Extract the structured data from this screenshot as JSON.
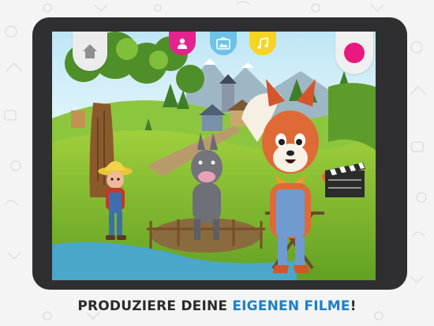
{
  "caption": {
    "part1": "PRODUZIERE DEINE ",
    "highlight": "EIGENEN FILME",
    "part2": "!"
  },
  "toolbar": {
    "home_icon": "home-icon",
    "tabs": [
      {
        "name": "character",
        "icon": "person-icon",
        "color": "#e5238f"
      },
      {
        "name": "scene",
        "icon": "scene-icon",
        "color": "#6cc3e8"
      },
      {
        "name": "music",
        "icon": "music-note-icon",
        "color": "#f5d422"
      }
    ],
    "record_color": "#e8197f"
  },
  "colors": {
    "caption_text": "#2b2b2b",
    "caption_accent": "#1d7fc4",
    "tablet_frame": "#2f2f31"
  }
}
